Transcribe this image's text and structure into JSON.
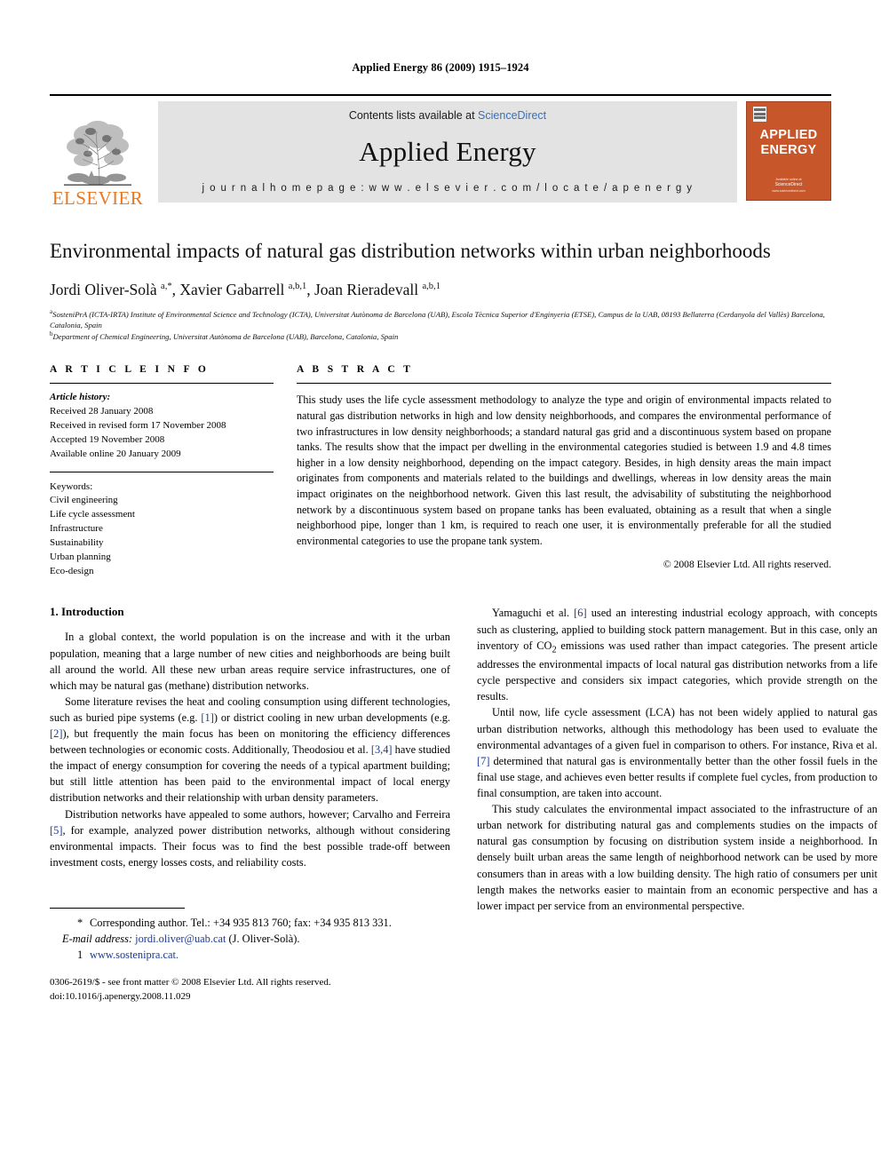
{
  "running_head": "Applied Energy 86 (2009) 1915–1924",
  "masthead": {
    "publisher": "ELSEVIER",
    "contents_prefix": "Contents lists available at ",
    "contents_link": "ScienceDirect",
    "journal_title": "Applied Energy",
    "homepage": "j o u r n a l   h o m e p a g e :   w w w . e l s e v i e r . c o m / l o c a t e / a p e n e r g y",
    "cover_title_line1": "APPLIED",
    "cover_title_line2": "ENERGY",
    "cover_foot_small": "Available online at",
    "cover_foot_sd": "ScienceDirect",
    "cover_foot_url": "www.sciencedirect.com",
    "accent_orange": "#E87722",
    "cover_bg": "#C8562B",
    "link_blue": "#3A6FB5"
  },
  "article": {
    "title": "Environmental impacts of natural gas distribution networks within urban neighborhoods",
    "authors_html": "Jordi Oliver-Solà <sup>a,*</sup>, Xavier Gabarrell <sup>a,b,1</sup>, Joan Rieradevall <sup>a,b,1</sup>",
    "affiliation_a": "SosteniPrA (ICTA-IRTA) Institute of Environmental Science and Technology (ICTA), Universitat Autònoma de Barcelona (UAB), Escola Tècnica Superior d'Enginyeria (ETSE), Campus de la UAB, 08193 Bellaterra (Cerdanyola del Vallès) Barcelona, Catalonia, Spain",
    "affiliation_b": "Department of Chemical Engineering, Universitat Autònoma de Barcelona (UAB), Barcelona, Catalonia, Spain"
  },
  "info": {
    "label": "A R T I C L E   I N F O",
    "history_head": "Article history:",
    "history": [
      "Received 28 January 2008",
      "Received in revised form 17 November 2008",
      "Accepted 19 November 2008",
      "Available online 20 January 2009"
    ],
    "keywords_head": "Keywords:",
    "keywords": [
      "Civil engineering",
      "Life cycle assessment",
      "Infrastructure",
      "Sustainability",
      "Urban planning",
      "Eco-design"
    ]
  },
  "abstract": {
    "label": "A B S T R A C T",
    "text": "This study uses the life cycle assessment methodology to analyze the type and origin of environmental impacts related to natural gas distribution networks in high and low density neighborhoods, and compares the environmental performance of two infrastructures in low density neighborhoods; a standard natural gas grid and a discontinuous system based on propane tanks. The results show that the impact per dwelling in the environmental categories studied is between 1.9 and 4.8 times higher in a low density neighborhood, depending on the impact category. Besides, in high density areas the main impact originates from components and materials related to the buildings and dwellings, whereas in low density areas the main impact originates on the neighborhood network. Given this last result, the advisability of substituting the neighborhood network by a discontinuous system based on propane tanks has been evaluated, obtaining as a result that when a single neighborhood pipe, longer than 1 km, is required to reach one user, it is environmentally preferable for all the studied environmental categories to use the propane tank system.",
    "copyright": "© 2008 Elsevier Ltd. All rights reserved."
  },
  "body": {
    "section_heading": "1. Introduction",
    "left_paragraphs": [
      "In a global context, the world population is on the increase and with it the urban population, meaning that a large number of new cities and neighborhoods are being built all around the world. All these new urban areas require service infrastructures, one of which may be natural gas (methane) distribution networks.",
      "Some literature revises the heat and cooling consumption using different technologies, such as buried pipe systems (e.g. [1]) or district cooling in new urban developments (e.g. [2]), but frequently the main focus has been on monitoring the efficiency differences between technologies or economic costs. Additionally, Theodosiou et al. [3,4] have studied the impact of energy consumption for covering the needs of a typical apartment building; but still little attention has been paid to the environmental impact of local energy distribution networks and their relationship with urban density parameters.",
      "Distribution networks have appealed to some authors, however; Carvalho and Ferreira [5], for example, analyzed power distribution networks, although without considering environmental impacts. Their focus was to find the best possible trade-off between investment costs, energy losses costs, and reliability costs."
    ],
    "right_paragraphs": [
      "Yamaguchi et al. [6] used an interesting industrial ecology approach, with concepts such as clustering, applied to building stock pattern management. But in this case, only an inventory of CO2 emissions was used rather than impact categories. The present article addresses the environmental impacts of local natural gas distribution networks from a life cycle perspective and considers six impact categories, which provide strength on the results.",
      "Until now, life cycle assessment (LCA) has not been widely applied to natural gas urban distribution networks, although this methodology has been used to evaluate the environmental advantages of a given fuel in comparison to others. For instance, Riva et al. [7] determined that natural gas is environmentally better than the other fossil fuels in the final use stage, and achieves even better results if complete fuel cycles, from production to final consumption, are taken into account.",
      "This study calculates the environmental impact associated to the infrastructure of an urban network for distributing natural gas and complements studies on the impacts of natural gas consumption by focusing on distribution system inside a neighborhood. In densely built urban areas the same length of neighborhood network can be used by more consumers than in areas with a low building density. The high ratio of consumers per unit length makes the networks easier to maintain from an economic perspective and has a lower impact per service from an environmental perspective."
    ]
  },
  "footnotes": {
    "corresponding_marker": "*",
    "corresponding_text": "Corresponding author. Tel.: +34 935 813 760; fax: +34 935 813 331.",
    "email_label": "E-mail address:",
    "email": "jordi.oliver@uab.cat",
    "email_suffix": "(J. Oliver-Solà).",
    "note_marker": "1",
    "note_url": "www.sostenipra.cat.",
    "issn_line": "0306-2619/$ - see front matter © 2008 Elsevier Ltd. All rights reserved.",
    "doi_line": "doi:10.1016/j.apenergy.2008.11.029"
  }
}
